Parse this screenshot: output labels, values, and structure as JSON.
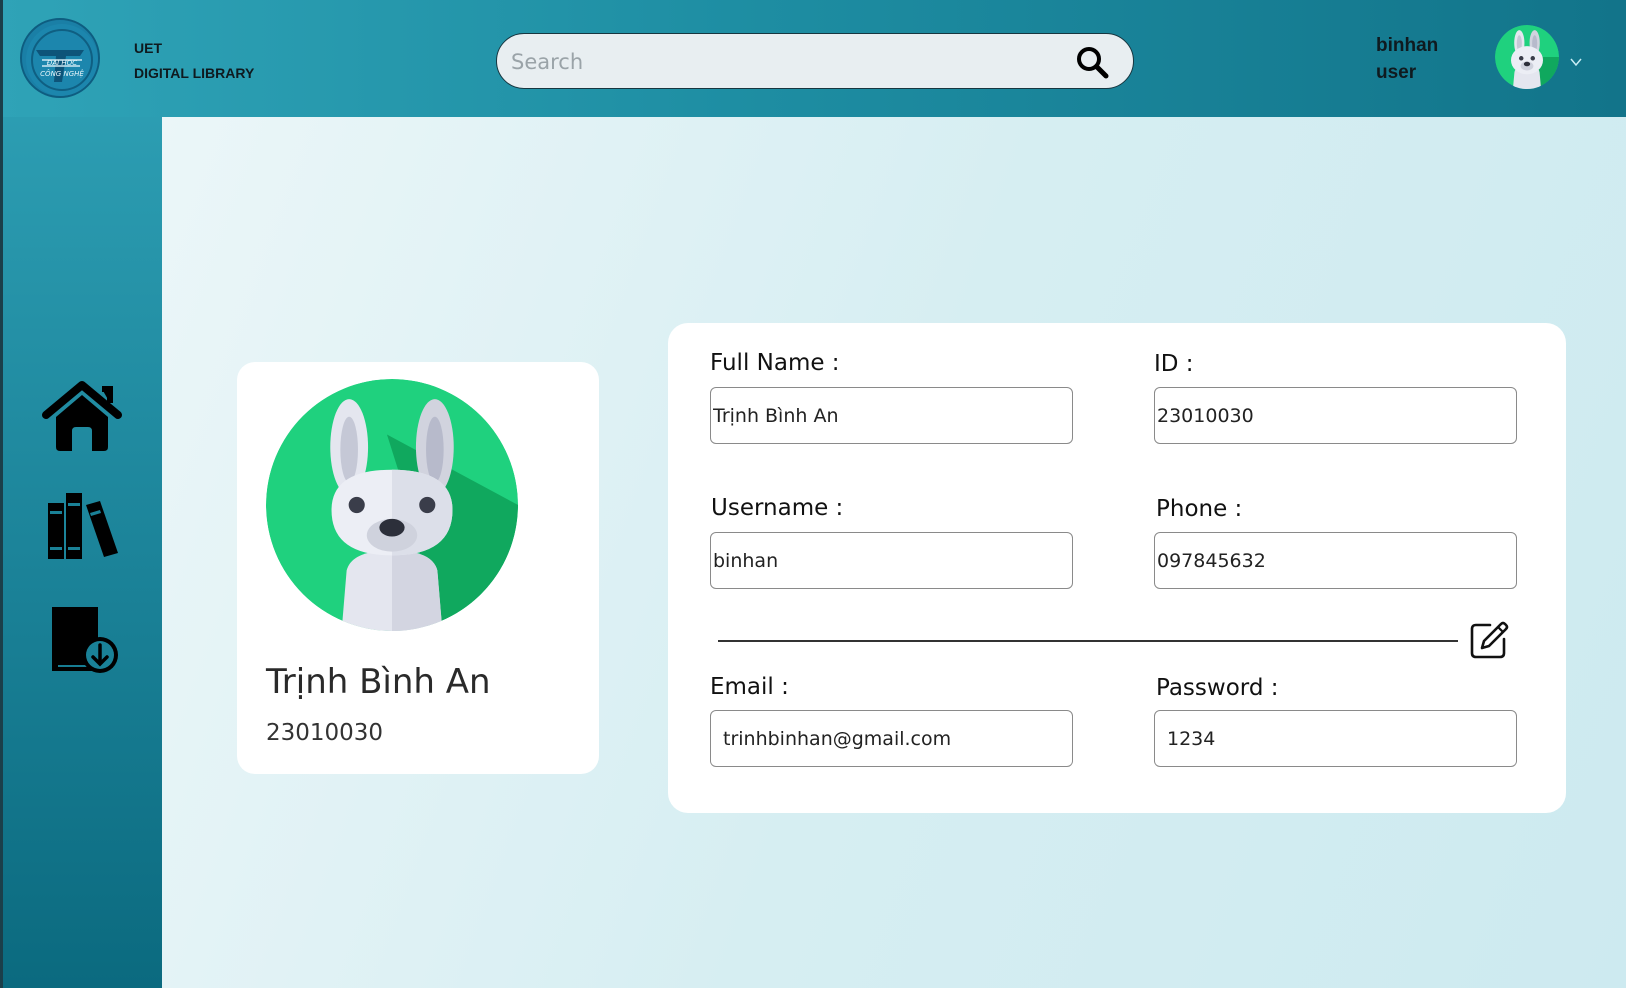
{
  "header": {
    "brand_line1": "UET",
    "brand_line2": "DIGITAL LIBRARY",
    "logo_text_top": "ĐẠI HỌC",
    "logo_text_bottom": "CÔNG NGHỆ",
    "search_placeholder": "Search",
    "search_value": "",
    "user_name": "binhan",
    "user_role": "user"
  },
  "sidebar": {
    "items": [
      {
        "icon": "home-icon"
      },
      {
        "icon": "books-icon"
      },
      {
        "icon": "book-download-icon"
      }
    ]
  },
  "profile": {
    "name": "Trịnh Bình An",
    "id": "23010030"
  },
  "form": {
    "full_name_label": "Full Name :",
    "full_name_value": "Trịnh Bình An",
    "id_label": "ID :",
    "id_value": "23010030",
    "username_label": "Username :",
    "username_value": "binhan",
    "phone_label": "Phone :",
    "phone_value": "097845632",
    "email_label": "Email :",
    "email_value": "trinhbinhan@gmail.com",
    "password_label": "Password :",
    "password_value": "1234"
  },
  "colors": {
    "topbar": "#1e8ea3",
    "avatar_green": "#1fd17e",
    "avatar_dark_green": "#10a85e"
  }
}
